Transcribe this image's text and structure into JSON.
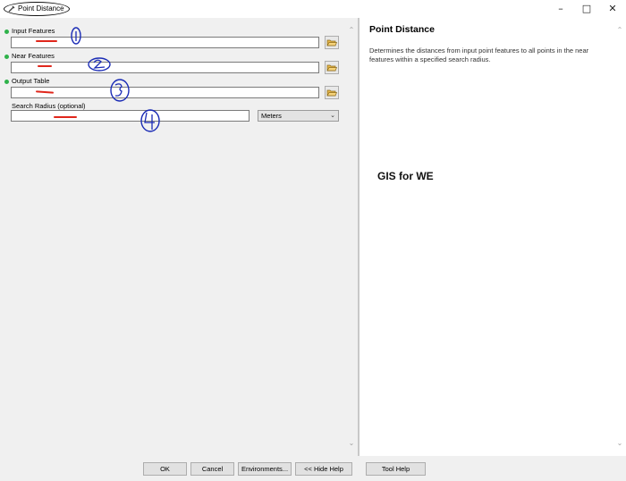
{
  "window": {
    "title": "Point Distance",
    "minimize_icon": "minimize-icon",
    "maximize_icon": "maximize-icon",
    "close_icon": "close-icon"
  },
  "parameters": [
    {
      "label": "Input Features",
      "value": "",
      "required": true
    },
    {
      "label": "Near Features",
      "value": "",
      "required": true
    },
    {
      "label": "Output Table",
      "value": "",
      "required": true
    },
    {
      "label": "Search Radius (optional)",
      "value": "",
      "required": false,
      "unit": "Meters"
    }
  ],
  "annotations": [
    "1",
    "2",
    "3",
    "4"
  ],
  "help": {
    "title": "Point Distance",
    "description": "Determines the distances from input point features to all points in the near features within a specified search radius."
  },
  "watermark": "GIS for WE",
  "buttons": {
    "ok": "OK",
    "cancel": "Cancel",
    "environments": "Environments...",
    "hide_help": "<< Hide Help",
    "tool_help": "Tool Help"
  },
  "colors": {
    "required_dot": "#2fb24a",
    "annotation_ink": "#1a2bb5",
    "underline_mark": "#e0271c",
    "panel_bg": "#f0f0f0"
  }
}
